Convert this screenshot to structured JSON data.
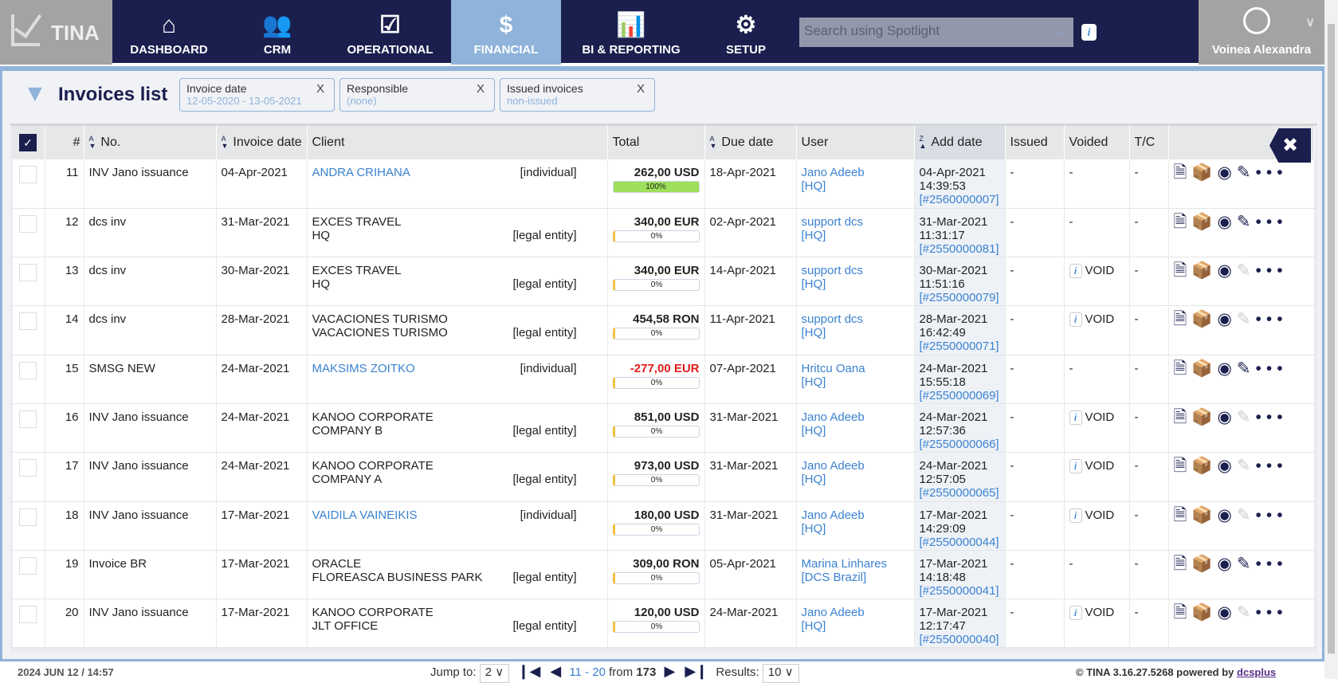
{
  "app": {
    "logo": "TINA"
  },
  "nav": [
    {
      "label": "DASHBOARD",
      "icon": "home-icon"
    },
    {
      "label": "CRM",
      "icon": "users-icon"
    },
    {
      "label": "OPERATIONAL",
      "icon": "clipboard-check-icon"
    },
    {
      "label": "FINANCIAL",
      "icon": "dollar-receipt-icon",
      "active": true
    },
    {
      "label": "BI & REPORTING",
      "icon": "report-chart-icon"
    },
    {
      "label": "SETUP",
      "icon": "gear-user-icon"
    }
  ],
  "search": {
    "placeholder": "Search using Spotlight",
    "dots": "...",
    "info": "i"
  },
  "user": {
    "name": "Voinea Alexandra"
  },
  "page": {
    "title": "Invoices list"
  },
  "filters": [
    {
      "label": "Invoice date",
      "value": "12-05-2020 - 13-05-2021"
    },
    {
      "label": "Responsible",
      "value": "(none)"
    },
    {
      "label": "Issued invoices",
      "value": "non-issued"
    }
  ],
  "columns": {
    "num": "#",
    "no": "No.",
    "invoice_date": "Invoice date",
    "client": "Client",
    "total": "Total",
    "due_date": "Due date",
    "user": "User",
    "add_date": "Add date",
    "issued": "Issued",
    "voided": "Voided",
    "tc": "T/C"
  },
  "rows": [
    {
      "n": "11",
      "no": "INV Jano issuance",
      "date": "04-Apr-2021",
      "client": [
        "ANDRA CRIHANA"
      ],
      "client_link": true,
      "type": "[individual]",
      "total": "262,00 USD",
      "paid": "100%",
      "due": "18-Apr-2021",
      "user": "Jano Adeeb",
      "branch": "[HQ]",
      "add_date": "04-Apr-2021",
      "add_time": "14:39:53",
      "ref": "[#2560000007]",
      "issued": "-",
      "voided": "-",
      "tc": "-",
      "editable": true
    },
    {
      "n": "12",
      "no": "dcs inv",
      "date": "31-Mar-2021",
      "client": [
        "EXCES TRAVEL",
        "HQ"
      ],
      "type": "[legal entity]",
      "total": "340,00 EUR",
      "paid": "0%",
      "due": "02-Apr-2021",
      "user": "support dcs",
      "branch": "[HQ]",
      "add_date": "31-Mar-2021",
      "add_time": "11:31:17",
      "ref": "[#2550000081]",
      "issued": "-",
      "voided": "-",
      "tc": "-",
      "editable": true
    },
    {
      "n": "13",
      "no": "dcs inv",
      "date": "30-Mar-2021",
      "client": [
        "EXCES TRAVEL",
        "HQ"
      ],
      "type": "[legal entity]",
      "total": "340,00 EUR",
      "paid": "0%",
      "due": "14-Apr-2021",
      "user": "support dcs",
      "branch": "[HQ]",
      "add_date": "30-Mar-2021",
      "add_time": "11:51:16",
      "ref": "[#2550000079]",
      "issued": "-",
      "voided": "VOID",
      "tc": "-",
      "editable": false
    },
    {
      "n": "14",
      "no": "dcs inv",
      "date": "28-Mar-2021",
      "client": [
        "VACACIONES TURISMO",
        "VACACIONES TURISMO"
      ],
      "type": "[legal entity]",
      "total": "454,58 RON",
      "paid": "0%",
      "due": "11-Apr-2021",
      "user": "support dcs",
      "branch": "[HQ]",
      "add_date": "28-Mar-2021",
      "add_time": "16:42:49",
      "ref": "[#2550000071]",
      "issued": "-",
      "voided": "VOID",
      "tc": "-",
      "editable": false
    },
    {
      "n": "15",
      "no": "SMSG NEW",
      "date": "24-Mar-2021",
      "client": [
        "MAKSIMS ZOITKO"
      ],
      "client_link": true,
      "type": "[individual]",
      "total": "-277,00 EUR",
      "negative": true,
      "paid": "0%",
      "due": "07-Apr-2021",
      "user": "Hritcu Oana",
      "branch": "[HQ]",
      "add_date": "24-Mar-2021",
      "add_time": "15:55:18",
      "ref": "[#2550000069]",
      "issued": "-",
      "voided": "-",
      "tc": "-",
      "editable": true
    },
    {
      "n": "16",
      "no": "INV Jano issuance",
      "date": "24-Mar-2021",
      "client": [
        "KANOO CORPORATE",
        "COMPANY B"
      ],
      "type": "[legal entity]",
      "total": "851,00 USD",
      "paid": "0%",
      "due": "31-Mar-2021",
      "user": "Jano Adeeb",
      "branch": "[HQ]",
      "add_date": "24-Mar-2021",
      "add_time": "12:57:36",
      "ref": "[#2550000066]",
      "issued": "-",
      "voided": "VOID",
      "tc": "-",
      "editable": false
    },
    {
      "n": "17",
      "no": "INV Jano issuance",
      "date": "24-Mar-2021",
      "client": [
        "KANOO CORPORATE",
        "COMPANY A"
      ],
      "type": "[legal entity]",
      "total": "973,00 USD",
      "paid": "0%",
      "due": "31-Mar-2021",
      "user": "Jano Adeeb",
      "branch": "[HQ]",
      "add_date": "24-Mar-2021",
      "add_time": "12:57:05",
      "ref": "[#2550000065]",
      "issued": "-",
      "voided": "VOID",
      "tc": "-",
      "editable": false
    },
    {
      "n": "18",
      "no": "INV Jano issuance",
      "date": "17-Mar-2021",
      "client": [
        "VAIDILA VAINEIKIS"
      ],
      "client_link": true,
      "type": "[individual]",
      "total": "180,00 USD",
      "paid": "0%",
      "due": "31-Mar-2021",
      "user": "Jano Adeeb",
      "branch": "[HQ]",
      "add_date": "17-Mar-2021",
      "add_time": "14:29:09",
      "ref": "[#2550000044]",
      "issued": "-",
      "voided": "VOID",
      "tc": "-",
      "editable": false
    },
    {
      "n": "19",
      "no": "Invoice BR",
      "date": "17-Mar-2021",
      "client": [
        "ORACLE",
        "FLOREASCA BUSINESS PARK"
      ],
      "type": "[legal entity]",
      "total": "309,00 RON",
      "paid": "0%",
      "due": "05-Apr-2021",
      "user": "Marina Linhares",
      "branch": "[DCS Brazil]",
      "add_date": "17-Mar-2021",
      "add_time": "14:18:48",
      "ref": "[#2550000041]",
      "issued": "-",
      "voided": "-",
      "tc": "-",
      "editable": true
    },
    {
      "n": "20",
      "no": "INV Jano issuance",
      "date": "17-Mar-2021",
      "client": [
        "KANOO CORPORATE",
        "JLT OFFICE"
      ],
      "type": "[legal entity]",
      "total": "120,00 USD",
      "paid": "0%",
      "due": "24-Mar-2021",
      "user": "Jano Adeeb",
      "branch": "[HQ]",
      "add_date": "17-Mar-2021",
      "add_time": "12:17:47",
      "ref": "[#2550000040]",
      "issued": "-",
      "voided": "VOID",
      "tc": "-",
      "editable": false
    }
  ],
  "footer": {
    "datetime": "2024 JUN 12 / 14:57",
    "jump_label": "Jump to:",
    "jump_value": "2",
    "range": "11 - 20",
    "from": "from",
    "total": "173",
    "results_label": "Results:",
    "results_value": "10",
    "copyright": "© TINA 3.16.27.5268 powered by",
    "brand": "dcsplus"
  }
}
